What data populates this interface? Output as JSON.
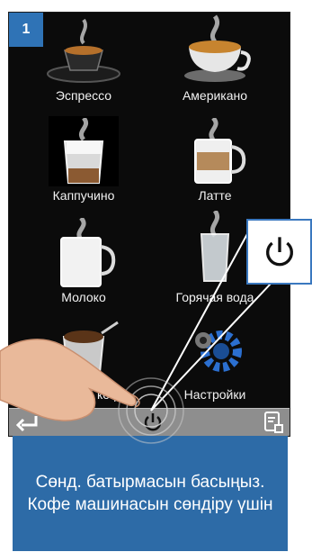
{
  "step_number": "1",
  "menu": {
    "items": [
      {
        "label": "Эспрессо",
        "icon": "espresso-cup-icon"
      },
      {
        "label": "Американо",
        "icon": "americano-cup-icon"
      },
      {
        "label": "Каппучино",
        "icon": "cappuccino-glass-icon"
      },
      {
        "label": "Латте",
        "icon": "latte-glass-icon"
      },
      {
        "label": "Молоко",
        "icon": "milk-mug-icon"
      },
      {
        "label": "Горячая вода",
        "icon": "hot-water-glass-icon"
      },
      {
        "label": "Молотый кофе",
        "icon": "ground-coffee-icon"
      },
      {
        "label": "Настройки",
        "icon": "gears-icon"
      }
    ]
  },
  "bottom_bar": {
    "back_icon": "back-arrow-icon",
    "power_icon": "power-icon",
    "document_icon": "document-icon"
  },
  "callout": {
    "icon": "power-icon"
  },
  "instruction": {
    "text": "Сөнд. батырмасын басыңыз. Кофе машинасын сөндіру үшін"
  },
  "colors": {
    "accent": "#2d6ba7",
    "badge": "#2f73b6",
    "screen": "#0b0b0b",
    "bar": "#8e8e8e"
  }
}
